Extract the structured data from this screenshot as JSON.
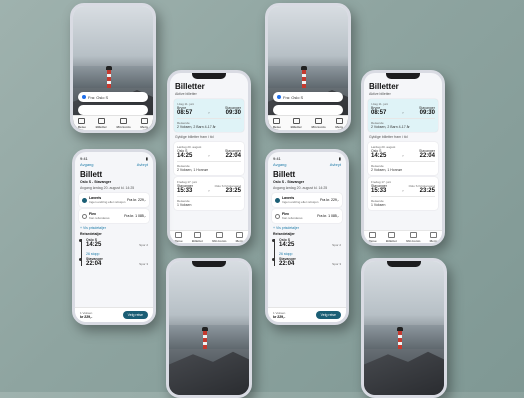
{
  "search": {
    "from_label": "Fra: Oslo S"
  },
  "tabbar": [
    "Reise",
    "Billetter",
    "Min konto",
    "Meny"
  ],
  "tickets": {
    "status_time": "9:41",
    "title": "Billetter",
    "active_heading": "Aktive billetter",
    "active": {
      "date": "I dag 11. juni",
      "from": "Bryne",
      "to": "Stavanger",
      "dep": "08:57",
      "arr": "09:30",
      "type_label": "Reisende",
      "pax": "2 Voksen, 2 Barn 4-17 år"
    },
    "upcoming_heading": "Gyldige billetter fram i tid",
    "up1": {
      "date": "Lørdag 20. august",
      "from": "Oslo S",
      "to": "Stavanger",
      "dep": "14:25",
      "arr": "22:04",
      "type_label": "Reisende",
      "pax": "2 Voksen, 1 Honnør"
    },
    "up2": {
      "date": "Fredag 17. juni",
      "from": "Stavanger",
      "to": "Oslo S Kristiansand",
      "dep": "15:33",
      "arr": "23:25",
      "type_label": "Reisende",
      "pax": "1 Voksen"
    }
  },
  "billett": {
    "status_time": "9:41",
    "back": "Avgang",
    "cancel": "Avbryt",
    "title": "Billett",
    "route": "Oslo S - Stavanger",
    "meta": "Avgang lørdag 20. august kl. 14:25",
    "opt1": {
      "name": "Laveris",
      "note": "Ingen endring eller refusjon",
      "price": "Fra kr. 229,-"
    },
    "opt2": {
      "name": "Flex",
      "note": "Kan refunderes",
      "price": "Fra kr. 1 085,-"
    },
    "more": "+ Vis prisdetaljer",
    "details_heading": "Reisedetaljer",
    "leg1": {
      "place": "Oslo S",
      "time": "14:25",
      "track": "Spor 2"
    },
    "stops": "26 stopp",
    "leg2": {
      "place": "Stavanger",
      "time": "22:04",
      "track": "Spor 3"
    },
    "total_label": "1 Voksen",
    "total": "kr 229,-",
    "cta": "Velg reise"
  }
}
